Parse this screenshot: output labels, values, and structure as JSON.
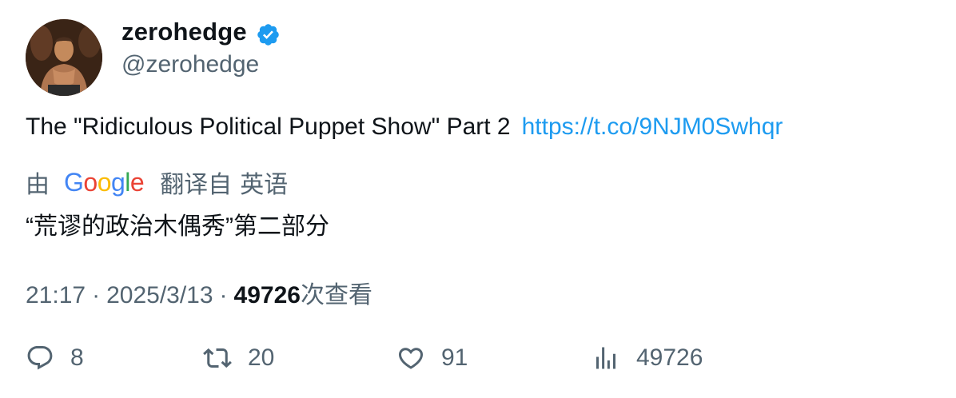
{
  "author": {
    "display_name": "zerohedge",
    "handle": "@zerohedge",
    "verified": true,
    "verified_color": "#1d9bf0"
  },
  "tweet": {
    "text": "The \"Ridiculous Political Puppet Show\" Part 2",
    "link": "https://t.co/9NJM0Swhqr",
    "link_color": "#1d9bf0"
  },
  "translation": {
    "by_prefix": "由",
    "provider": "Google",
    "translated_from": "翻译自",
    "source_language": "英语",
    "translated_text": "“荒谬的政治木偶秀”第二部分"
  },
  "meta": {
    "time": "21:17",
    "separator": "·",
    "date": "2025/3/13",
    "views_count": "49726",
    "views_label": "次查看"
  },
  "actions": {
    "reply": {
      "icon": "reply-icon",
      "count": "8"
    },
    "retweet": {
      "icon": "retweet-icon",
      "count": "20"
    },
    "like": {
      "icon": "heart-icon",
      "count": "91"
    },
    "views": {
      "icon": "analytics-icon",
      "count": "49726"
    }
  }
}
